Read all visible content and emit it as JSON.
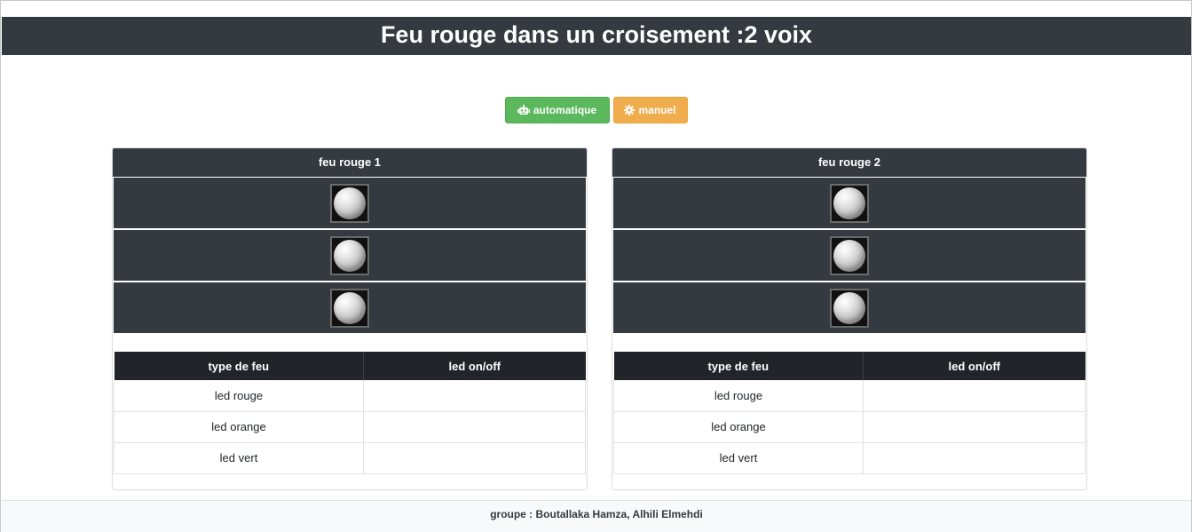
{
  "header": {
    "title": "Feu rouge dans un croisement :2 voix"
  },
  "buttons": {
    "auto": {
      "label": "automatique",
      "icon": "robot-icon",
      "color": "#5cb85c"
    },
    "manual": {
      "label": "manuel",
      "icon": "gear-icon",
      "color": "#f0ad4e"
    }
  },
  "panels": [
    {
      "title": "feu rouge 1",
      "table": {
        "headers": [
          "type de feu",
          "led on/off"
        ],
        "rows": [
          {
            "type": "led rouge",
            "state": ""
          },
          {
            "type": "led orange",
            "state": ""
          },
          {
            "type": "led vert",
            "state": ""
          }
        ]
      }
    },
    {
      "title": "feu rouge 2",
      "table": {
        "headers": [
          "type de feu",
          "led on/off"
        ],
        "rows": [
          {
            "type": "led rouge",
            "state": ""
          },
          {
            "type": "led orange",
            "state": ""
          },
          {
            "type": "led vert",
            "state": ""
          }
        ]
      }
    }
  ],
  "footer": {
    "text": "groupe : Boutallaka Hamza, Alhili Elmehdi"
  },
  "colors": {
    "dark": "#343a40",
    "table_head": "#212529"
  }
}
